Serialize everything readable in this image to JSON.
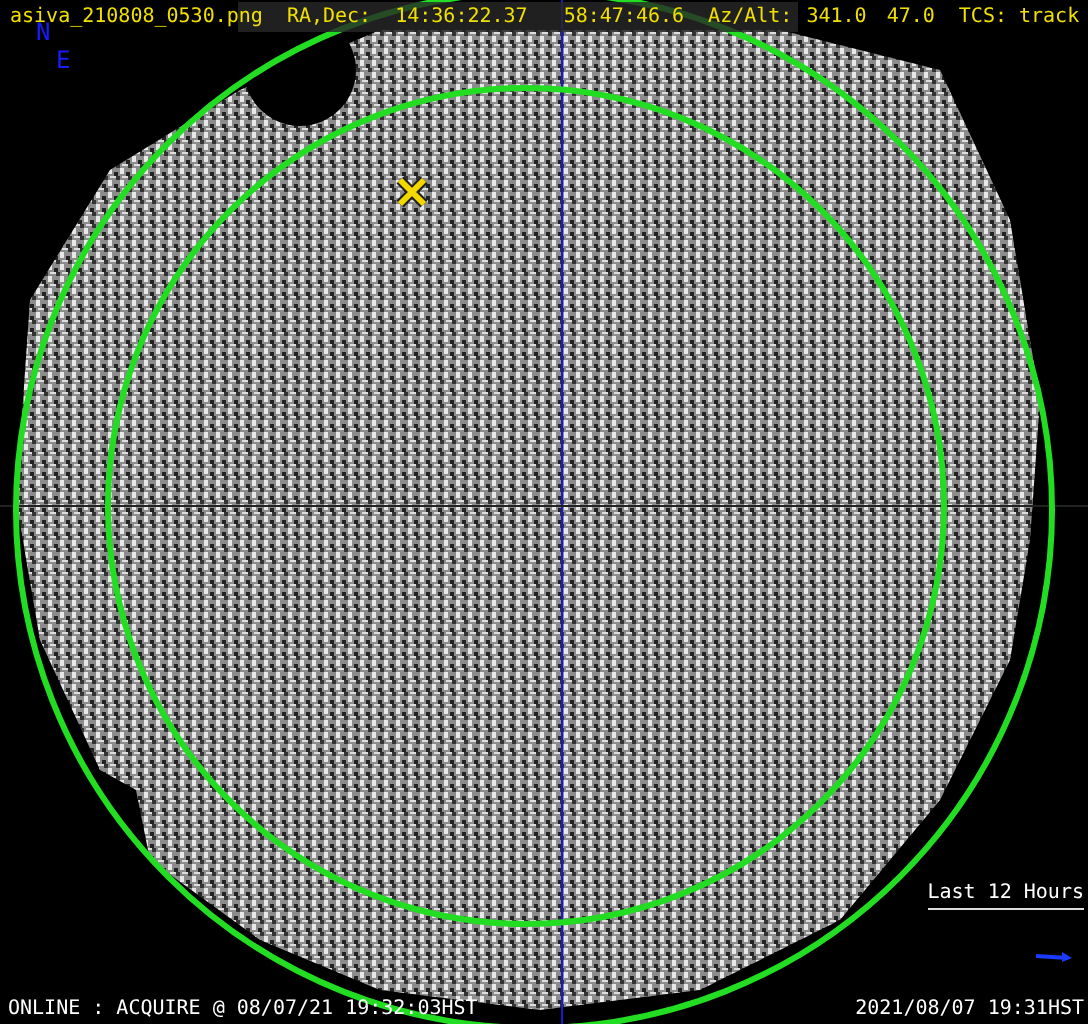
{
  "header": {
    "filename": "asiva_210808_0530.png",
    "ra_dec_label": "RA,Dec:",
    "ra": "14:36:22.37",
    "dec": "58:47:46.6",
    "az_alt_label": "Az/Alt:",
    "az": "341.0",
    "alt": "47.0",
    "tcs_label": "TCS:",
    "tcs": "track"
  },
  "compass": {
    "north": "N",
    "east": "E"
  },
  "legend": {
    "label": "Last 12 Hours"
  },
  "status": "ONLINE : ACQUIRE @ 08/07/21 19:32:03HST",
  "timestamp": "2021/08/07 19:31HST"
}
